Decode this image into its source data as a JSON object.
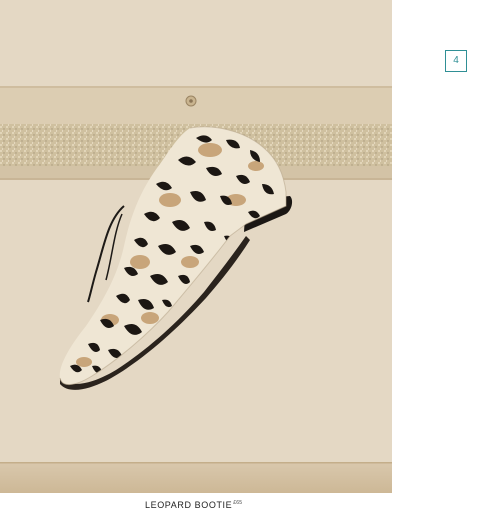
{
  "page": {
    "number": "4"
  },
  "product": {
    "name": "LEOPARD BOOTIE",
    "price": "£65"
  },
  "photo": {
    "subject": "leopard-print-bootie-icon",
    "colors": {
      "wall": "#e4d8c4",
      "shelf": "#d8c7ab",
      "glitter_band": "#cdbd9c",
      "accent": "#2f8f95"
    }
  }
}
